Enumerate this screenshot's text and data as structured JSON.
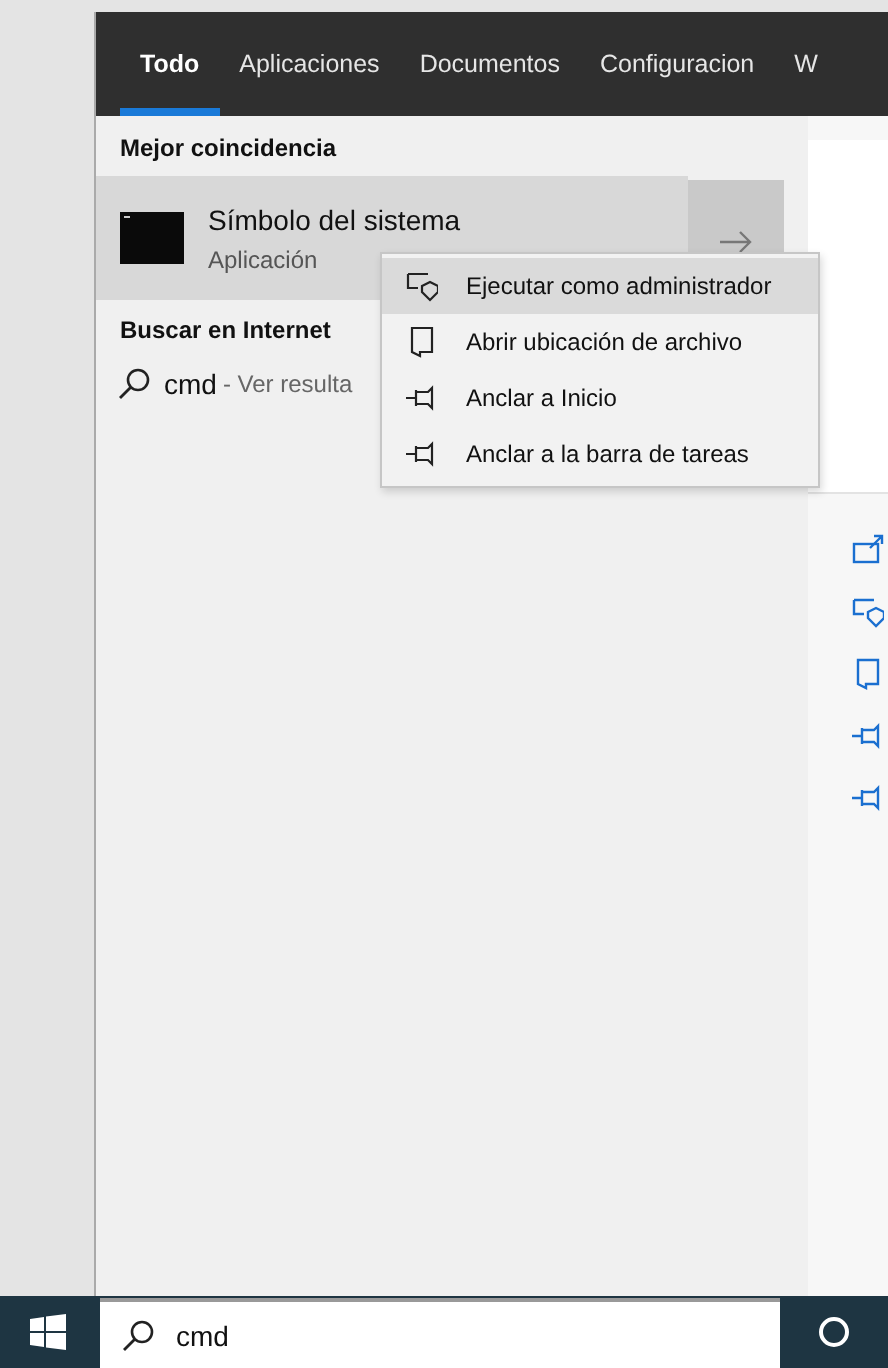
{
  "tabs": [
    {
      "label": "Todo",
      "selected": true
    },
    {
      "label": "Aplicaciones",
      "selected": false
    },
    {
      "label": "Documentos",
      "selected": false
    },
    {
      "label": "Configuracion",
      "selected": false
    },
    {
      "label": "W",
      "selected": false
    }
  ],
  "best_match": {
    "heading": "Mejor coincidencia",
    "title": "Símbolo del sistema",
    "subtitle": "Aplicación"
  },
  "web_search": {
    "heading": "Buscar en Internet",
    "query": "cmd",
    "hint": "- Ver resulta"
  },
  "context_menu": [
    {
      "label": "Ejecutar como administrador",
      "kind": "shield",
      "selected": true
    },
    {
      "label": "Abrir ubicación de archivo",
      "kind": "folder",
      "selected": false
    },
    {
      "label": "Anclar a Inicio",
      "kind": "pin",
      "selected": false
    },
    {
      "label": "Anclar a la barra de tareas",
      "kind": "pin",
      "selected": false
    }
  ],
  "side_actions": [
    {
      "kind": "open"
    },
    {
      "kind": "shield"
    },
    {
      "kind": "folder"
    },
    {
      "kind": "pin"
    },
    {
      "kind": "pin"
    }
  ],
  "taskbar": {
    "search_value": "cmd"
  }
}
